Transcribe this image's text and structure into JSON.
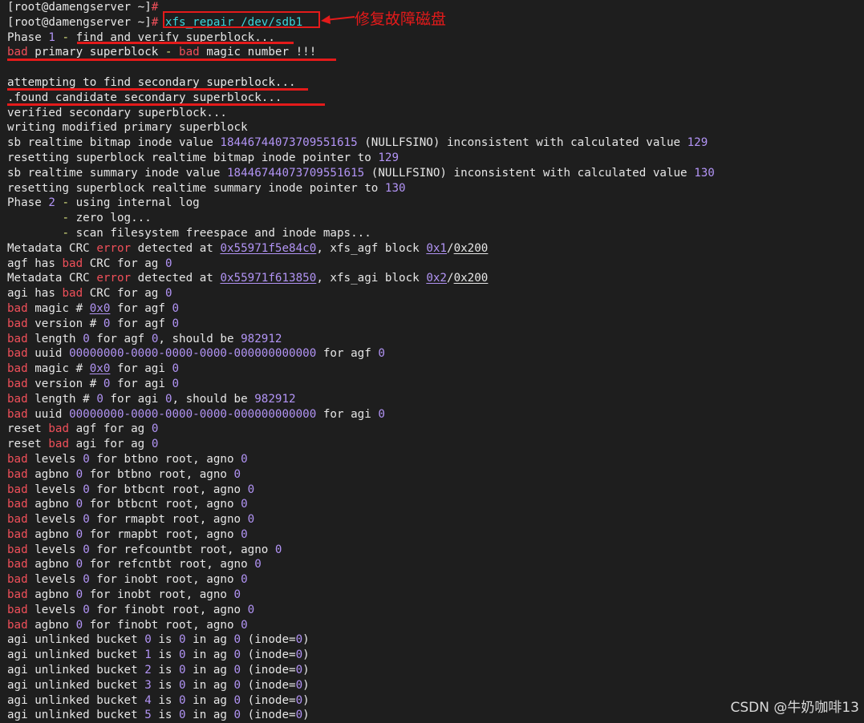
{
  "annotation": "修复故障磁盘",
  "watermark": "CSDN @牛奶咖啡13",
  "terminal": {
    "lines": [
      [
        [
          "n",
          "[root@damengserver ~]"
        ],
        [
          "r",
          "#"
        ]
      ],
      [
        [
          "n",
          "[root@damengserver ~]"
        ],
        [
          "r",
          "#"
        ],
        [
          "n",
          " "
        ],
        [
          "c",
          "xfs_repair /dev/sdb1"
        ]
      ],
      [
        [
          "n",
          "Phase "
        ],
        [
          "p",
          "1"
        ],
        [
          "g",
          " - "
        ],
        [
          "n",
          "find and verify superblock..."
        ]
      ],
      [
        [
          "r",
          "bad"
        ],
        [
          "n",
          " primary superblock "
        ],
        [
          "g",
          "-"
        ],
        [
          "n",
          " "
        ],
        [
          "r",
          "bad"
        ],
        [
          "n",
          " magic number !!!"
        ]
      ],
      [
        [
          "n",
          ""
        ]
      ],
      [
        [
          "n",
          "attempting to find secondary superblock..."
        ]
      ],
      [
        [
          "n",
          ".found candidate secondary superblock..."
        ]
      ],
      [
        [
          "n",
          "verified secondary superblock..."
        ]
      ],
      [
        [
          "n",
          "writing modified primary superblock"
        ]
      ],
      [
        [
          "n",
          "sb realtime bitmap inode value "
        ],
        [
          "p",
          "18446744073709551615"
        ],
        [
          "n",
          " ("
        ],
        [
          "n",
          "NULLFSINO"
        ],
        [
          "n",
          ") inconsistent with calculated value "
        ],
        [
          "p",
          "129"
        ]
      ],
      [
        [
          "n",
          "resetting superblock realtime bitmap inode pointer to "
        ],
        [
          "p",
          "129"
        ]
      ],
      [
        [
          "n",
          "sb realtime summary inode value "
        ],
        [
          "p",
          "18446744073709551615"
        ],
        [
          "n",
          " ("
        ],
        [
          "n",
          "NULLFSINO"
        ],
        [
          "n",
          ") inconsistent with calculated value "
        ],
        [
          "p",
          "130"
        ]
      ],
      [
        [
          "n",
          "resetting superblock realtime summary inode pointer to "
        ],
        [
          "p",
          "130"
        ]
      ],
      [
        [
          "n",
          "Phase "
        ],
        [
          "p",
          "2"
        ],
        [
          "g",
          " - "
        ],
        [
          "n",
          "using internal log"
        ]
      ],
      [
        [
          "n",
          "        "
        ],
        [
          "g",
          "-"
        ],
        [
          "n",
          " zero log..."
        ]
      ],
      [
        [
          "n",
          "        "
        ],
        [
          "g",
          "-"
        ],
        [
          "n",
          " scan filesystem freespace and inode maps..."
        ]
      ],
      [
        [
          "n",
          "Metadata CRC "
        ],
        [
          "r",
          "error"
        ],
        [
          "n",
          " detected at "
        ],
        [
          "u",
          "0x55971f5e84c0"
        ],
        [
          "n",
          ", xfs_agf block "
        ],
        [
          "u",
          "0x1"
        ],
        [
          "n",
          "/"
        ],
        [
          "w",
          "0x200"
        ]
      ],
      [
        [
          "n",
          "agf has "
        ],
        [
          "r",
          "bad"
        ],
        [
          "n",
          " CRC for ag "
        ],
        [
          "p",
          "0"
        ]
      ],
      [
        [
          "n",
          "Metadata CRC "
        ],
        [
          "r",
          "error"
        ],
        [
          "n",
          " detected at "
        ],
        [
          "u",
          "0x55971f613850"
        ],
        [
          "n",
          ", xfs_agi block "
        ],
        [
          "u",
          "0x2"
        ],
        [
          "n",
          "/"
        ],
        [
          "w",
          "0x200"
        ]
      ],
      [
        [
          "n",
          "agi has "
        ],
        [
          "r",
          "bad"
        ],
        [
          "n",
          " CRC for ag "
        ],
        [
          "p",
          "0"
        ]
      ],
      [
        [
          "r",
          "bad"
        ],
        [
          "n",
          " magic # "
        ],
        [
          "u",
          "0x0"
        ],
        [
          "n",
          " for agf "
        ],
        [
          "p",
          "0"
        ]
      ],
      [
        [
          "r",
          "bad"
        ],
        [
          "n",
          " version # "
        ],
        [
          "p",
          "0"
        ],
        [
          "n",
          " for agf "
        ],
        [
          "p",
          "0"
        ]
      ],
      [
        [
          "r",
          "bad"
        ],
        [
          "n",
          " length "
        ],
        [
          "p",
          "0"
        ],
        [
          "n",
          " for agf "
        ],
        [
          "p",
          "0"
        ],
        [
          "n",
          ", should be "
        ],
        [
          "p",
          "982912"
        ]
      ],
      [
        [
          "r",
          "bad"
        ],
        [
          "n",
          " uuid "
        ],
        [
          "p",
          "00000000-0000-0000-0000-000000000000"
        ],
        [
          "n",
          " for agf "
        ],
        [
          "p",
          "0"
        ]
      ],
      [
        [
          "r",
          "bad"
        ],
        [
          "n",
          " magic # "
        ],
        [
          "u",
          "0x0"
        ],
        [
          "n",
          " for agi "
        ],
        [
          "p",
          "0"
        ]
      ],
      [
        [
          "r",
          "bad"
        ],
        [
          "n",
          " version # "
        ],
        [
          "p",
          "0"
        ],
        [
          "n",
          " for agi "
        ],
        [
          "p",
          "0"
        ]
      ],
      [
        [
          "r",
          "bad"
        ],
        [
          "n",
          " length # "
        ],
        [
          "p",
          "0"
        ],
        [
          "n",
          " for agi "
        ],
        [
          "p",
          "0"
        ],
        [
          "n",
          ", should be "
        ],
        [
          "p",
          "982912"
        ]
      ],
      [
        [
          "r",
          "bad"
        ],
        [
          "n",
          " uuid "
        ],
        [
          "p",
          "00000000-0000-0000-0000-000000000000"
        ],
        [
          "n",
          " for agi "
        ],
        [
          "p",
          "0"
        ]
      ],
      [
        [
          "n",
          "reset "
        ],
        [
          "r",
          "bad"
        ],
        [
          "n",
          " agf for ag "
        ],
        [
          "p",
          "0"
        ]
      ],
      [
        [
          "n",
          "reset "
        ],
        [
          "r",
          "bad"
        ],
        [
          "n",
          " agi for ag "
        ],
        [
          "p",
          "0"
        ]
      ],
      [
        [
          "r",
          "bad"
        ],
        [
          "n",
          " levels "
        ],
        [
          "p",
          "0"
        ],
        [
          "n",
          " for btbno root, agno "
        ],
        [
          "p",
          "0"
        ]
      ],
      [
        [
          "r",
          "bad"
        ],
        [
          "n",
          " agbno "
        ],
        [
          "p",
          "0"
        ],
        [
          "n",
          " for btbno root, agno "
        ],
        [
          "p",
          "0"
        ]
      ],
      [
        [
          "r",
          "bad"
        ],
        [
          "n",
          " levels "
        ],
        [
          "p",
          "0"
        ],
        [
          "n",
          " for btbcnt root, agno "
        ],
        [
          "p",
          "0"
        ]
      ],
      [
        [
          "r",
          "bad"
        ],
        [
          "n",
          " agbno "
        ],
        [
          "p",
          "0"
        ],
        [
          "n",
          " for btbcnt root, agno "
        ],
        [
          "p",
          "0"
        ]
      ],
      [
        [
          "r",
          "bad"
        ],
        [
          "n",
          " levels "
        ],
        [
          "p",
          "0"
        ],
        [
          "n",
          " for rmapbt root, agno "
        ],
        [
          "p",
          "0"
        ]
      ],
      [
        [
          "r",
          "bad"
        ],
        [
          "n",
          " agbno "
        ],
        [
          "p",
          "0"
        ],
        [
          "n",
          " for rmapbt root, agno "
        ],
        [
          "p",
          "0"
        ]
      ],
      [
        [
          "r",
          "bad"
        ],
        [
          "n",
          " levels "
        ],
        [
          "p",
          "0"
        ],
        [
          "n",
          " for refcountbt root, agno "
        ],
        [
          "p",
          "0"
        ]
      ],
      [
        [
          "r",
          "bad"
        ],
        [
          "n",
          " agbno "
        ],
        [
          "p",
          "0"
        ],
        [
          "n",
          " for refcntbt root, agno "
        ],
        [
          "p",
          "0"
        ]
      ],
      [
        [
          "r",
          "bad"
        ],
        [
          "n",
          " levels "
        ],
        [
          "p",
          "0"
        ],
        [
          "n",
          " for inobt root, agno "
        ],
        [
          "p",
          "0"
        ]
      ],
      [
        [
          "r",
          "bad"
        ],
        [
          "n",
          " agbno "
        ],
        [
          "p",
          "0"
        ],
        [
          "n",
          " for inobt root, agno "
        ],
        [
          "p",
          "0"
        ]
      ],
      [
        [
          "r",
          "bad"
        ],
        [
          "n",
          " levels "
        ],
        [
          "p",
          "0"
        ],
        [
          "n",
          " for finobt root, agno "
        ],
        [
          "p",
          "0"
        ]
      ],
      [
        [
          "r",
          "bad"
        ],
        [
          "n",
          " agbno "
        ],
        [
          "p",
          "0"
        ],
        [
          "n",
          " for finobt root, agno "
        ],
        [
          "p",
          "0"
        ]
      ],
      [
        [
          "n",
          "agi unlinked bucket "
        ],
        [
          "p",
          "0"
        ],
        [
          "n",
          " is "
        ],
        [
          "p",
          "0"
        ],
        [
          "n",
          " in ag "
        ],
        [
          "p",
          "0"
        ],
        [
          "n",
          " (inode="
        ],
        [
          "p",
          "0"
        ],
        [
          "n",
          ")"
        ]
      ],
      [
        [
          "n",
          "agi unlinked bucket "
        ],
        [
          "p",
          "1"
        ],
        [
          "n",
          " is "
        ],
        [
          "p",
          "0"
        ],
        [
          "n",
          " in ag "
        ],
        [
          "p",
          "0"
        ],
        [
          "n",
          " (inode="
        ],
        [
          "p",
          "0"
        ],
        [
          "n",
          ")"
        ]
      ],
      [
        [
          "n",
          "agi unlinked bucket "
        ],
        [
          "p",
          "2"
        ],
        [
          "n",
          " is "
        ],
        [
          "p",
          "0"
        ],
        [
          "n",
          " in ag "
        ],
        [
          "p",
          "0"
        ],
        [
          "n",
          " (inode="
        ],
        [
          "p",
          "0"
        ],
        [
          "n",
          ")"
        ]
      ],
      [
        [
          "n",
          "agi unlinked bucket "
        ],
        [
          "p",
          "3"
        ],
        [
          "n",
          " is "
        ],
        [
          "p",
          "0"
        ],
        [
          "n",
          " in ag "
        ],
        [
          "p",
          "0"
        ],
        [
          "n",
          " (inode="
        ],
        [
          "p",
          "0"
        ],
        [
          "n",
          ")"
        ]
      ],
      [
        [
          "n",
          "agi unlinked bucket "
        ],
        [
          "p",
          "4"
        ],
        [
          "n",
          " is "
        ],
        [
          "p",
          "0"
        ],
        [
          "n",
          " in ag "
        ],
        [
          "p",
          "0"
        ],
        [
          "n",
          " (inode="
        ],
        [
          "p",
          "0"
        ],
        [
          "n",
          ")"
        ]
      ],
      [
        [
          "n",
          "agi unlinked bucket "
        ],
        [
          "p",
          "5"
        ],
        [
          "n",
          " is "
        ],
        [
          "p",
          "0"
        ],
        [
          "n",
          " in ag "
        ],
        [
          "p",
          "0"
        ],
        [
          "n",
          " (inode="
        ],
        [
          "p",
          "0"
        ],
        [
          "n",
          ")"
        ]
      ]
    ]
  }
}
